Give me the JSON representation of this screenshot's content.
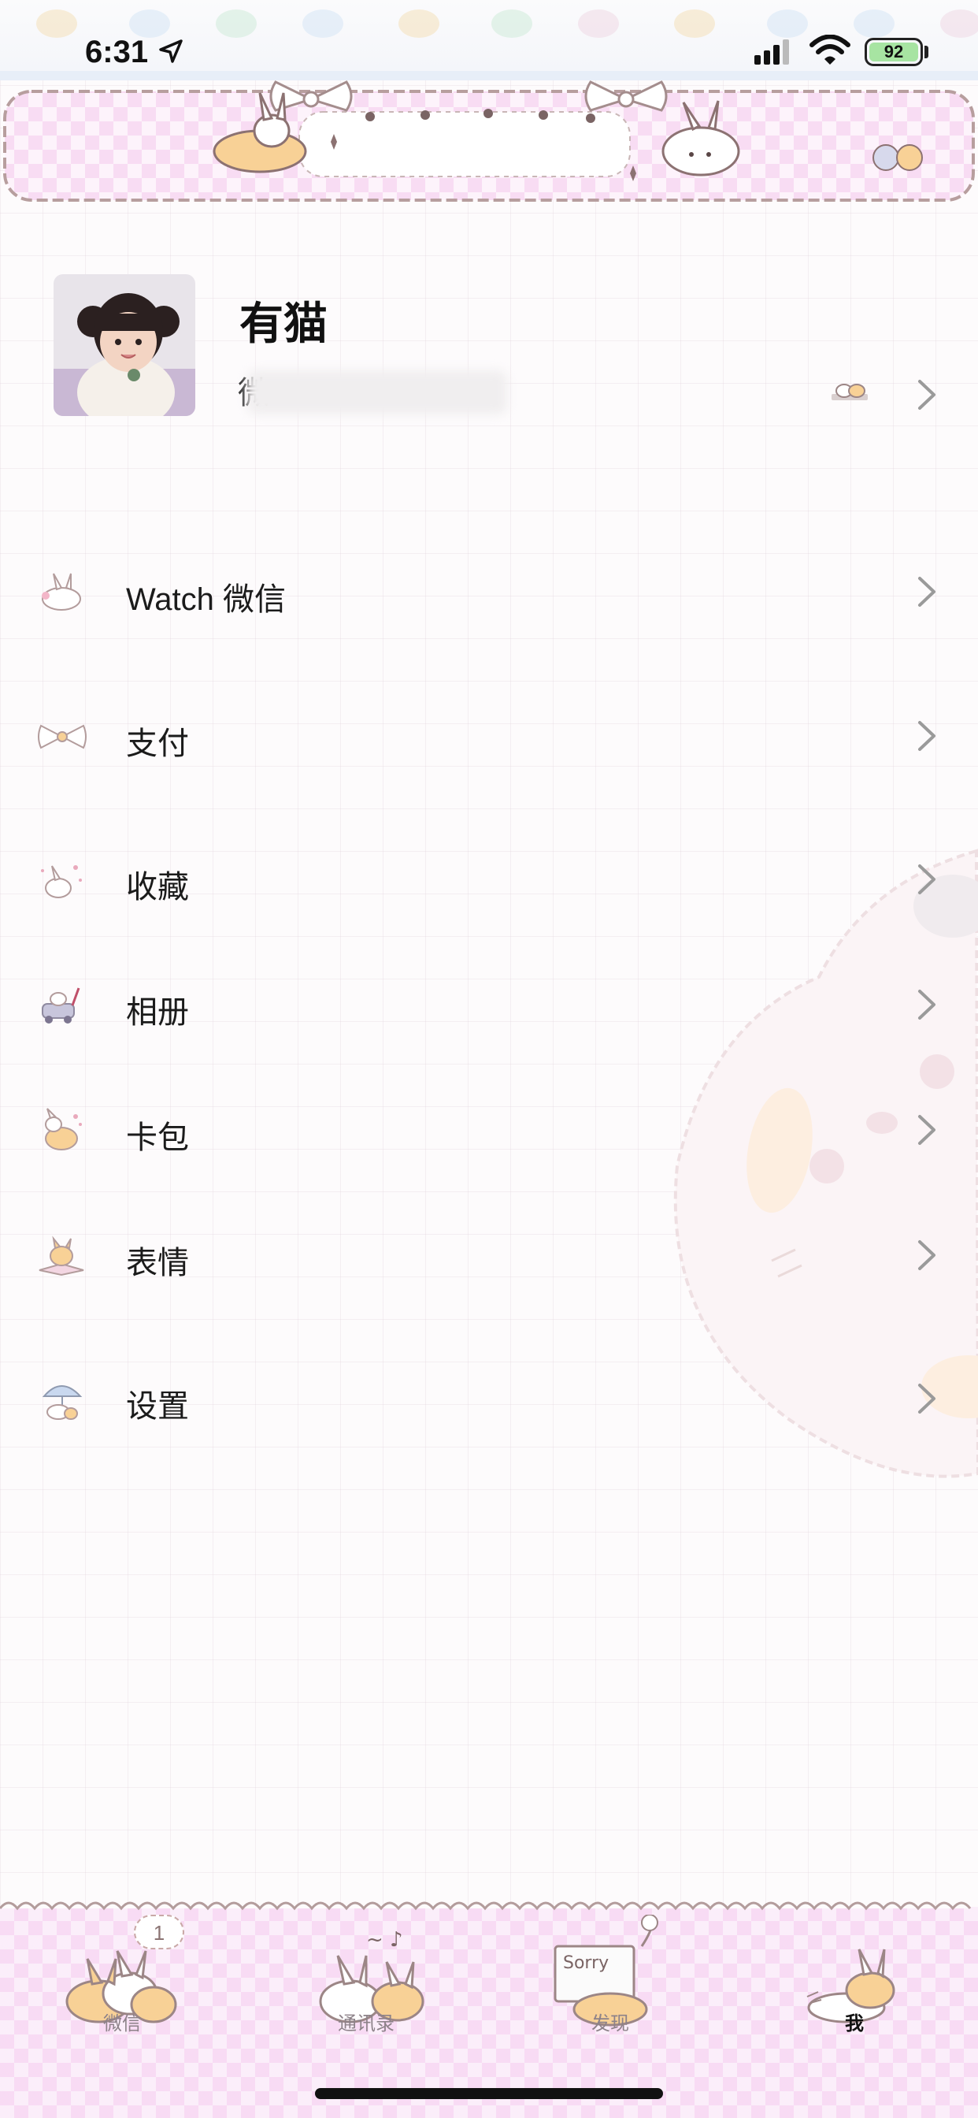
{
  "status_bar": {
    "time": "6:31",
    "battery_level": "92",
    "battery_color": "#a7e4a2",
    "icons": [
      "location-arrow-icon",
      "cellular-signal-icon",
      "wifi-icon",
      "battery-icon"
    ]
  },
  "profile": {
    "name": "有猫",
    "wechat_id_prefix": "微",
    "icons": [
      "status-sticker-icon",
      "chevron-right-icon"
    ]
  },
  "menu": [
    {
      "label": "Watch 微信",
      "icon": "bunny-watch-icon"
    },
    {
      "label": "支付",
      "icon": "bow-payment-icon"
    },
    {
      "label": "收藏",
      "icon": "sparkle-bunny-favorites-icon"
    },
    {
      "label": "相册",
      "icon": "bunny-car-album-icon"
    },
    {
      "label": "卡包",
      "icon": "bunny-cat-cards-icon"
    },
    {
      "label": "表情",
      "icon": "cat-reading-stickers-icon"
    },
    {
      "label": "设置",
      "icon": "umbrella-cat-settings-icon"
    }
  ],
  "tab_bar": {
    "tabs": [
      {
        "label": "微信",
        "badge": "1",
        "active": false
      },
      {
        "label": "通讯录",
        "active": false
      },
      {
        "label": "发现",
        "sign_text": "Sorry",
        "active": false
      },
      {
        "label": "我",
        "active": true
      }
    ]
  },
  "colors": {
    "accent_pink": "#f7d6f2",
    "banner_border": "#b9a2a2",
    "chevron": "#9a9a9a"
  }
}
